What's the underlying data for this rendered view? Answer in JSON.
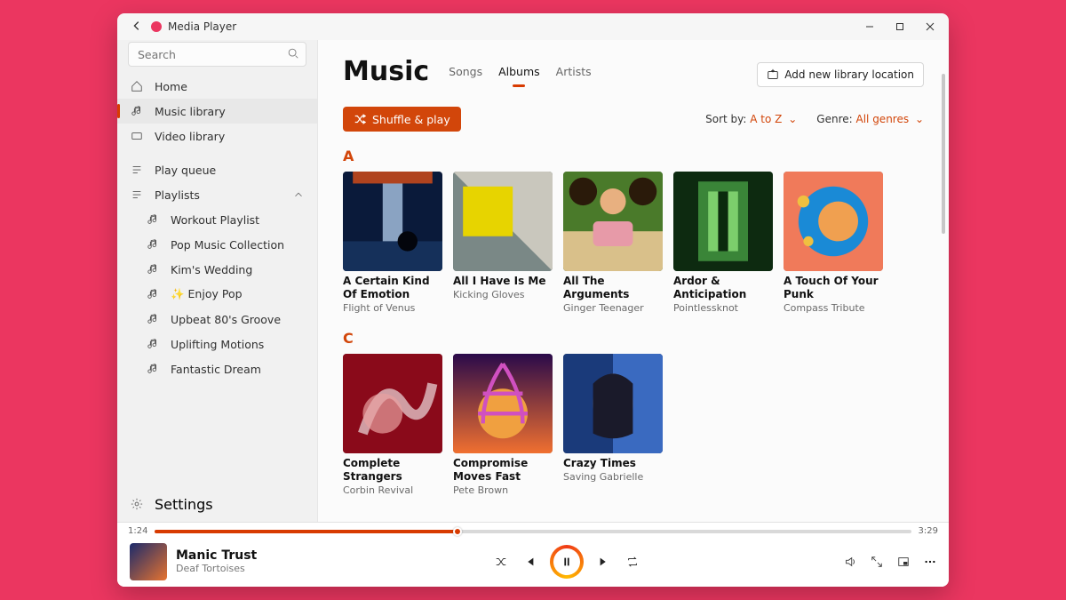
{
  "app_title": "Media Player",
  "search_placeholder": "Search",
  "sidebar": {
    "home": "Home",
    "music_library": "Music library",
    "video_library": "Video library",
    "play_queue": "Play queue",
    "playlists": "Playlists",
    "playlist_items": [
      "Workout Playlist",
      "Pop Music Collection",
      "Kim's Wedding",
      "✨ Enjoy Pop",
      "Upbeat 80's Groove",
      "Uplifting Motions",
      "Fantastic Dream"
    ],
    "settings": "Settings"
  },
  "header": {
    "title": "Music",
    "tabs": [
      "Songs",
      "Albums",
      "Artists"
    ],
    "active_tab": "Albums",
    "add_library": "Add new library location"
  },
  "toolbar": {
    "shuffle": "Shuffle & play",
    "sort_label": "Sort by:",
    "sort_value": "A to Z",
    "genre_label": "Genre:",
    "genre_value": "All genres"
  },
  "sections": [
    {
      "letter": "A",
      "albums": [
        {
          "title": "A Certain Kind Of Emotion",
          "artist": "Flight of Venus"
        },
        {
          "title": "All I Have Is Me",
          "artist": "Kicking Gloves"
        },
        {
          "title": "All The Arguments",
          "artist": "Ginger Teenager"
        },
        {
          "title": "Ardor & Anticipation",
          "artist": "Pointlessknot"
        },
        {
          "title": "A Touch Of Your Punk",
          "artist": "Compass Tribute"
        }
      ]
    },
    {
      "letter": "C",
      "albums": [
        {
          "title": "Complete Strangers",
          "artist": "Corbin Revival"
        },
        {
          "title": "Compromise Moves Fast",
          "artist": "Pete Brown"
        },
        {
          "title": "Crazy Times",
          "artist": "Saving Gabrielle"
        }
      ]
    }
  ],
  "player": {
    "elapsed": "1:24",
    "duration": "3:29",
    "percent": 40,
    "title": "Manic Trust",
    "artist": "Deaf Tortoises"
  }
}
